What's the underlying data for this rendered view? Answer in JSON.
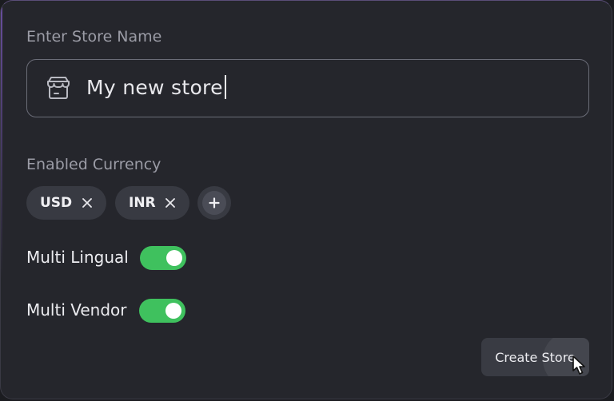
{
  "store_name": {
    "label": "Enter Store Name",
    "value": "My new store",
    "icon": "store-icon"
  },
  "currency": {
    "label": "Enabled Currency",
    "chips": [
      {
        "code": "USD",
        "remove_icon": "close-icon"
      },
      {
        "code": "INR",
        "remove_icon": "close-icon"
      }
    ],
    "add_icon": "plus-icon"
  },
  "options": [
    {
      "label": "Multi Lingual",
      "enabled": true
    },
    {
      "label": "Multi Vendor",
      "enabled": true
    }
  ],
  "actions": {
    "create_label": "Create Store"
  },
  "colors": {
    "toggle_on": "#3fc15e",
    "card_bg": "#25262c"
  }
}
